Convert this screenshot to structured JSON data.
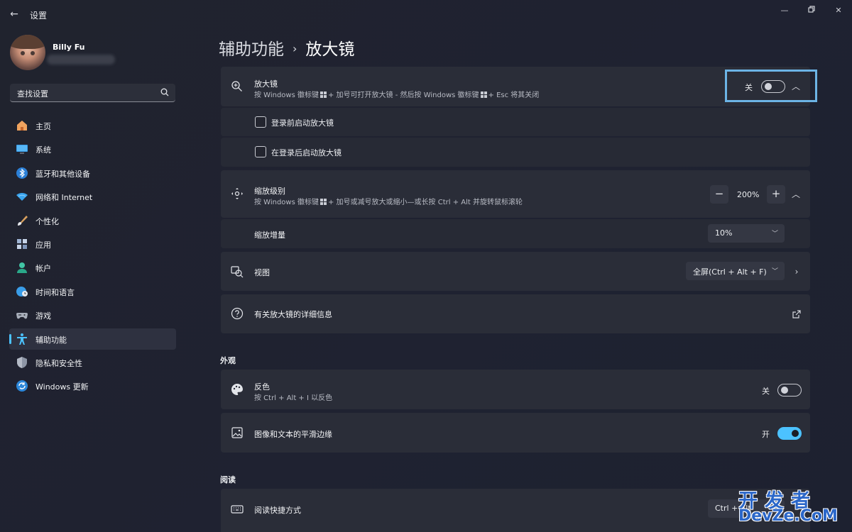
{
  "window": {
    "title": "设置",
    "controls": [
      "minimize",
      "restore",
      "close"
    ]
  },
  "profile": {
    "name": "Billy Fu"
  },
  "search": {
    "placeholder": "查找设置"
  },
  "sidebar": {
    "items": [
      {
        "label": "主页",
        "icon": "home-icon"
      },
      {
        "label": "系统",
        "icon": "system-icon"
      },
      {
        "label": "蓝牙和其他设备",
        "icon": "bluetooth-icon"
      },
      {
        "label": "网络和 Internet",
        "icon": "wifi-icon"
      },
      {
        "label": "个性化",
        "icon": "brush-icon"
      },
      {
        "label": "应用",
        "icon": "apps-icon"
      },
      {
        "label": "帐户",
        "icon": "account-icon"
      },
      {
        "label": "时间和语言",
        "icon": "globe-clock-icon"
      },
      {
        "label": "游戏",
        "icon": "gamepad-icon"
      },
      {
        "label": "辅助功能",
        "icon": "accessibility-icon",
        "active": true
      },
      {
        "label": "隐私和安全性",
        "icon": "shield-icon"
      },
      {
        "label": "Windows 更新",
        "icon": "update-icon"
      }
    ]
  },
  "breadcrumb": {
    "parent": "辅助功能",
    "separator": "›",
    "current": "放大镜"
  },
  "magnifier": {
    "title": "放大镜",
    "desc_part1": "按 Windows 徽标键",
    "desc_part2": "+ 加号可打开放大镜 - 然后按 Windows 徽标键",
    "desc_part3": "+ Esc 将其关闭",
    "toggle_label": "关",
    "toggle_on": false,
    "options": [
      {
        "label": "登录前启动放大镜",
        "checked": false
      },
      {
        "label": "在登录后启动放大镜",
        "checked": false
      }
    ]
  },
  "zoom": {
    "title": "缩放级别",
    "desc_part1": "按 Windows 徽标键",
    "desc_part2": "+ 加号或减号放大或缩小—或长按 Ctrl + Alt 并旋转鼠标滚轮",
    "minus": "−",
    "value": "200%",
    "plus": "+",
    "increment_label": "缩放增量",
    "increment_value": "10%"
  },
  "view": {
    "title": "视图",
    "value": "全屏(Ctrl + Alt + F)"
  },
  "info": {
    "title": "有关放大镜的详细信息"
  },
  "appearance": {
    "section": "外观",
    "invert_title": "反色",
    "invert_desc": "按 Ctrl + Alt + I 以反色",
    "invert_toggle_label": "关",
    "invert_on": false,
    "smooth_title": "图像和文本的平滑边缘",
    "smooth_toggle_label": "开",
    "smooth_on": true
  },
  "reading": {
    "section": "阅读",
    "shortcut_title": "阅读快捷方式",
    "shortcut_value": "Ctrl + Alt"
  },
  "watermark": {
    "line1": "开发者",
    "line2": "DevZe.CoM"
  },
  "colors": {
    "accent": "#4cc2ff",
    "background": "#20232e",
    "card": "#2a2d38",
    "highlight_border": "#6cb4e6",
    "watermark": "#2b67c9"
  }
}
